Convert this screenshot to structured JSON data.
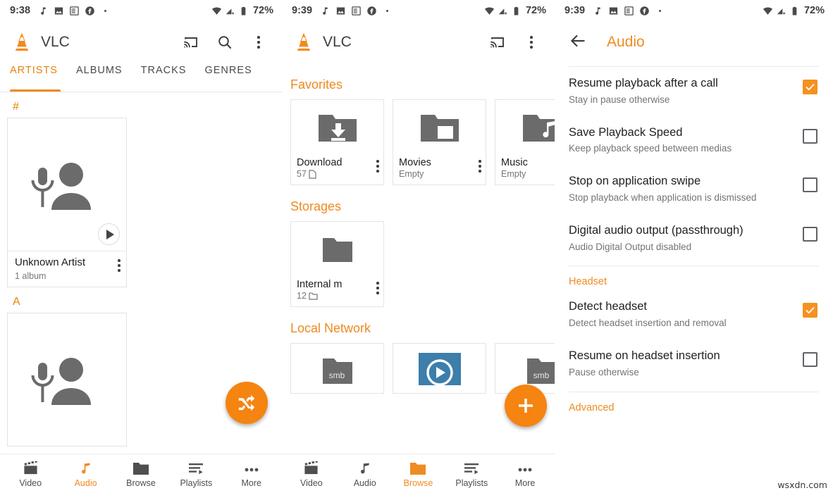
{
  "panels": {
    "artists": {
      "status": {
        "time": "9:38",
        "battery": "72%",
        "icons": [
          "music-note-icon",
          "photo-icon",
          "article-icon",
          "facebook-icon",
          "dot-icon"
        ],
        "right_icons": [
          "wifi-icon",
          "signal-off-icon",
          "battery-icon"
        ]
      },
      "appbar": {
        "title": "VLC",
        "actions": [
          "cast-icon",
          "search-icon",
          "overflow-icon"
        ]
      },
      "tabs": [
        {
          "label": "ARTISTS",
          "active": true
        },
        {
          "label": "ALBUMS",
          "active": false
        },
        {
          "label": "TRACKS",
          "active": false
        },
        {
          "label": "GENRES",
          "active": false
        }
      ],
      "sections": [
        {
          "letter": "#",
          "cards": [
            {
              "name": "Unknown Artist",
              "sub": "1 album"
            }
          ]
        },
        {
          "letter": "A",
          "cards": [
            {
              "name": "",
              "sub": ""
            }
          ]
        }
      ],
      "fab": {
        "icon": "shuffle-icon"
      },
      "bottomnav": [
        {
          "label": "Video",
          "icon": "movie-icon",
          "active": false
        },
        {
          "label": "Audio",
          "icon": "music-note-icon",
          "active": true
        },
        {
          "label": "Browse",
          "icon": "folder-icon",
          "active": false
        },
        {
          "label": "Playlists",
          "icon": "playlist-icon",
          "active": false
        },
        {
          "label": "More",
          "icon": "more-icon",
          "active": false
        }
      ]
    },
    "browse": {
      "status": {
        "time": "9:39",
        "battery": "72%"
      },
      "appbar": {
        "title": "VLC",
        "actions": [
          "cast-icon",
          "overflow-icon"
        ]
      },
      "sections": [
        {
          "title": "Favorites",
          "cards": [
            {
              "name": "Download",
              "sub": "57",
              "sub_icon": "file-icon",
              "icon": "folder-download-icon"
            },
            {
              "name": "Movies",
              "sub": "Empty",
              "sub_icon": "",
              "icon": "folder-movie-icon"
            },
            {
              "name": "Music",
              "sub": "Empty",
              "sub_icon": "",
              "icon": "folder-music-icon"
            }
          ]
        },
        {
          "title": "Storages",
          "cards": [
            {
              "name": "Internal m",
              "sub": "12",
              "sub_icon": "folder-small-icon",
              "icon": "folder-icon"
            }
          ]
        },
        {
          "title": "Local Network",
          "cards": [
            {
              "name": "",
              "sub": "",
              "icon": "folder-smb-icon",
              "badge": "smb"
            },
            {
              "name": "",
              "sub": "",
              "icon": "video-thumb-icon"
            },
            {
              "name": "",
              "sub": "",
              "icon": "folder-smb-icon",
              "badge": "smb"
            }
          ]
        }
      ],
      "fab": {
        "icon": "add-icon"
      },
      "bottomnav": [
        {
          "label": "Video",
          "icon": "movie-icon",
          "active": false
        },
        {
          "label": "Audio",
          "icon": "music-note-icon",
          "active": false
        },
        {
          "label": "Browse",
          "icon": "folder-icon",
          "active": true
        },
        {
          "label": "Playlists",
          "icon": "playlist-icon",
          "active": false
        },
        {
          "label": "More",
          "icon": "more-icon",
          "active": false
        }
      ]
    },
    "audio_settings": {
      "status": {
        "time": "9:39",
        "battery": "72%"
      },
      "appbar": {
        "back_icon": "arrow-back-icon",
        "title": "Audio"
      },
      "prefs": [
        {
          "title": "Resume playback after a call",
          "sub": "Stay in pause otherwise",
          "checked": true
        },
        {
          "title": "Save Playback Speed",
          "sub": "Keep playback speed between medias",
          "checked": false
        },
        {
          "title": "Stop on application swipe",
          "sub": "Stop playback when application is dismissed",
          "checked": false
        },
        {
          "title": "Digital audio output (passthrough)",
          "sub": "Audio Digital Output disabled",
          "checked": false
        }
      ],
      "group_headset": "Headset",
      "headset_prefs": [
        {
          "title": "Detect headset",
          "sub": "Detect headset insertion and removal",
          "checked": true
        },
        {
          "title": "Resume on headset insertion",
          "sub": "Pause otherwise",
          "checked": false
        }
      ],
      "group_advanced": "Advanced"
    }
  },
  "watermark": "wsxdn.com",
  "colors": {
    "accent": "#ef8b22",
    "accent_dark": "#e8820c",
    "fab": "#f58410",
    "text": "#202124",
    "subtext": "#70757a",
    "icon_gray": "#616161",
    "video_blue": "#3d7eaa"
  }
}
